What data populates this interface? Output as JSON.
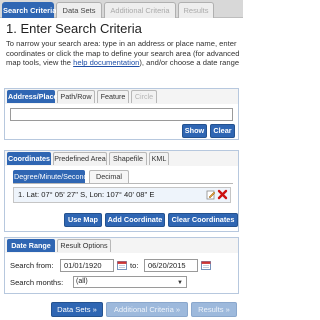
{
  "top_tabs": {
    "search_criteria": "Search Criteria",
    "data_sets": "Data Sets",
    "additional_criteria": "Additional Criteria",
    "results": "Results"
  },
  "heading": "1. Enter Search Criteria",
  "description": {
    "part1": "To narrow your search area: type in an address or place name, enter coordinates or click the map to define your search area (for advanced map tools, view the ",
    "link": "help documentation",
    "part2": "), and/or choose a date range"
  },
  "address_panel": {
    "tabs": [
      "Address/Place",
      "Path/Row",
      "Feature",
      "Circle"
    ],
    "input_value": "",
    "show_label": "Show",
    "clear_label": "Clear"
  },
  "coordinates_panel": {
    "tabs": [
      "Coordinates",
      "Predefined Area",
      "Shapefile",
      "KML"
    ],
    "subtabs": [
      "Degree/Minute/Second",
      "Decimal"
    ],
    "entry": "1.  Lat: 07° 05' 27\" S, Lon: 107° 40' 08\" E",
    "use_map_label": "Use Map",
    "add_coordinate_label": "Add Coordinate",
    "clear_coordinates_label": "Clear Coordinates"
  },
  "date_panel": {
    "tabs": [
      "Date Range",
      "Result Options"
    ],
    "search_from_label": "Search from:",
    "from_date": "01/01/1920",
    "to_label": "to:",
    "to_date": "06/20/2015",
    "months_label": "Search months:",
    "months_value": "(all)"
  },
  "bottom_buttons": {
    "data_sets": "Data Sets »",
    "additional_criteria": "Additional Criteria »",
    "results": "Results »"
  },
  "colors": {
    "accent": "#2f66b3",
    "panel_border": "#b7c8de",
    "delete_red": "#cc1111"
  }
}
